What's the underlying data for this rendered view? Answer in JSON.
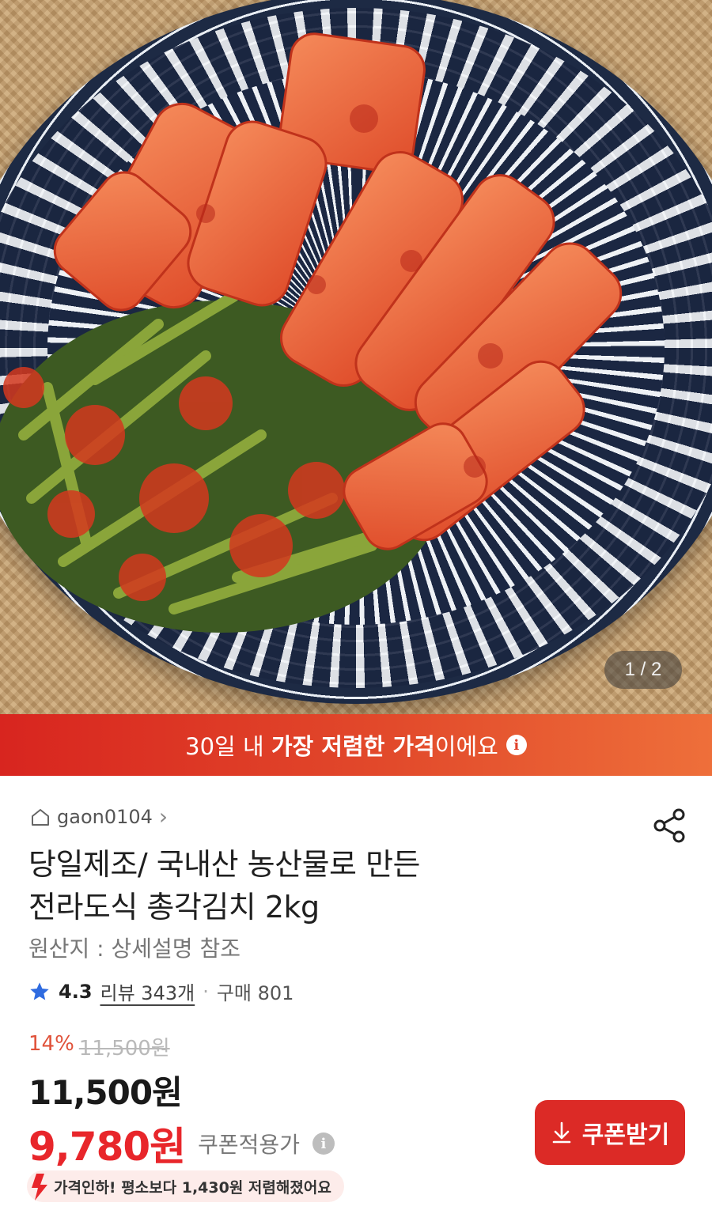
{
  "gallery": {
    "counter": "1 / 2",
    "image_alt_icon": "kimchi-photo"
  },
  "banner": {
    "prefix": "30일 내 ",
    "highlight": "가장 저렴한 가격",
    "suffix": "이에요",
    "info_icon": "i"
  },
  "store": {
    "name": "gaon0104",
    "chevron": "›"
  },
  "product": {
    "title_line1": "당일제조/ 국내산 농산물로 만든",
    "title_line2": "전라도식 총각김치 2kg",
    "origin": "원산지 : 상세설명 참조"
  },
  "rating": {
    "score": "4.3",
    "reviews": "리뷰 343개",
    "separator": "·",
    "purchases": "구매 801"
  },
  "price": {
    "discount_rate": "14%",
    "original": "11,500원",
    "current": "11,500원",
    "coupon_price": "9,780원",
    "coupon_label": "쿠폰적용가",
    "info_icon": "i"
  },
  "coupon_button": {
    "label": "쿠폰받기"
  },
  "price_drop": {
    "text": "가격인하! 평소보다 1,430원 저렴해졌어요"
  },
  "colors": {
    "accent_red": "#dc2a26",
    "banner_gradient_end": "#ee6f3a",
    "coupon_price_red": "#e8262b"
  }
}
